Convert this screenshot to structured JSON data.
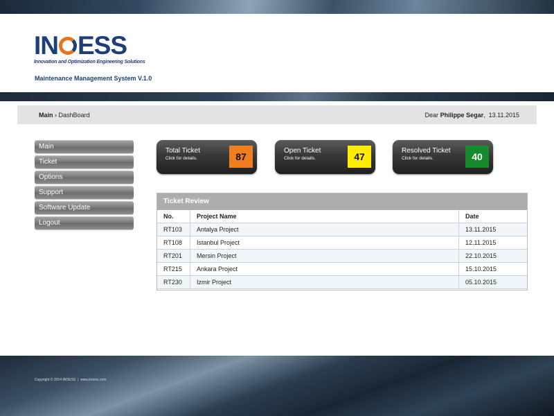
{
  "brand": {
    "name_left": "IN",
    "name_right": "ESS",
    "tagline": "Innovation and Optimization Engineering Solutions",
    "app_title": "Maintenance Management System V.1.0",
    "primary_color": "#1d3e7a",
    "accent_color": "#e8731a"
  },
  "breadcrumb": {
    "root": "Main",
    "separator": "›",
    "current": "DashBoard"
  },
  "greeting": {
    "prefix": "Dear",
    "user": "Philippe Segar",
    "date": "13.11.2015"
  },
  "sidebar": {
    "items": [
      {
        "label": "Main"
      },
      {
        "label": "Ticket"
      },
      {
        "label": "Options"
      },
      {
        "label": "Support"
      },
      {
        "label": "Software Update"
      },
      {
        "label": "Logout"
      }
    ]
  },
  "cards": [
    {
      "title": "Total Ticket",
      "subtitle": "Click for details.",
      "value": "87",
      "color": "#f07d1e"
    },
    {
      "title": "Open Ticket",
      "subtitle": "Click for details.",
      "value": "47",
      "color": "#ffec00"
    },
    {
      "title": "Resolved Ticket",
      "subtitle": "Click for details.",
      "value": "40",
      "color": "#168a2c"
    }
  ],
  "ticket_review": {
    "title": "Ticket Review",
    "columns": [
      "No.",
      "Project Name",
      "Date"
    ],
    "rows": [
      [
        "RT103",
        "Antalya Project",
        "13.11.2015"
      ],
      [
        "RT108",
        "Istanbul Project",
        "12.11.2015"
      ],
      [
        "RT201",
        "Mersin Project",
        "22.10.2015"
      ],
      [
        "RT215",
        "Ankara Project",
        "15.10.2015"
      ],
      [
        "RT230",
        "Izmir Project",
        "05.10.2015"
      ]
    ]
  },
  "footer": {
    "copyright": "Copyright © 2014 INOESS",
    "separator": "|",
    "site": "www.inoess.com"
  }
}
